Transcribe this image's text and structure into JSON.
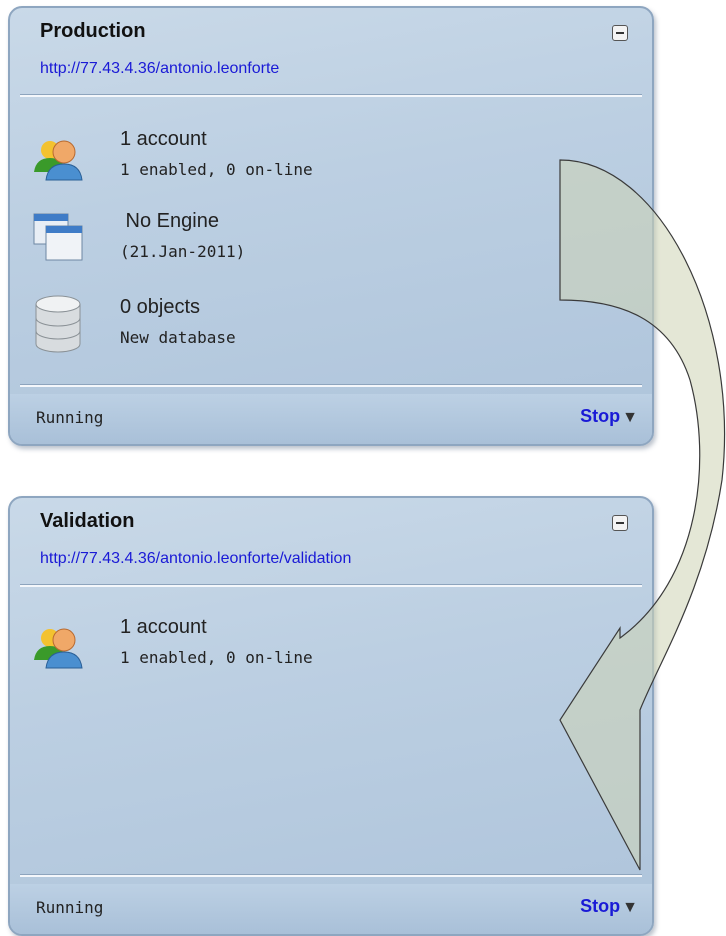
{
  "panels": [
    {
      "title": "Production",
      "url": "http://77.43.4.36/antonio.leonforte",
      "rows": [
        {
          "icon": "users-icon",
          "main": "1 account",
          "sub": "1 enabled, 0 on-line"
        },
        {
          "icon": "windows-icon",
          "main": " No Engine",
          "sub": "(21.Jan-2011)"
        },
        {
          "icon": "database-icon",
          "main": "0 objects",
          "sub": "New database"
        }
      ],
      "status": "Running",
      "action": "Stop"
    },
    {
      "title": "Validation",
      "url": "http://77.43.4.36/antonio.leonforte/validation",
      "rows": [
        {
          "icon": "users-icon",
          "main": "1 account",
          "sub": "1 enabled, 0 on-line"
        }
      ],
      "status": "Running",
      "action": "Stop"
    }
  ],
  "colors": {
    "link": "#1a1ad6",
    "panel_bg": "#b8cce0",
    "arrow_fill": "#c8d0b8"
  }
}
